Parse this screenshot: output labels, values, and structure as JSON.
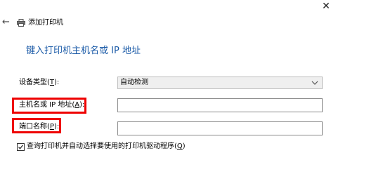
{
  "window": {
    "close_glyph": "✕",
    "back_glyph": "←",
    "title": "添加打印机"
  },
  "heading": "键入打印机主机名或 IP 地址",
  "form": {
    "device_type": {
      "label_prefix": "设备类型(",
      "label_key": "T",
      "label_suffix": "):",
      "value": "自动检测"
    },
    "hostname": {
      "label_prefix": "主机名或 IP 地址(",
      "label_key": "A",
      "label_suffix": "):",
      "value": ""
    },
    "port_name": {
      "label_prefix": "端口名称(",
      "label_key": "P",
      "label_suffix": "):",
      "value": ""
    },
    "query_driver": {
      "label_prefix": "查询打印机并自动选择要使用的打印机驱动程序(",
      "label_key": "Q",
      "label_suffix": ")",
      "checked": true
    }
  },
  "colors": {
    "heading": "#1a5aa7",
    "highlight": "#ee0000"
  }
}
